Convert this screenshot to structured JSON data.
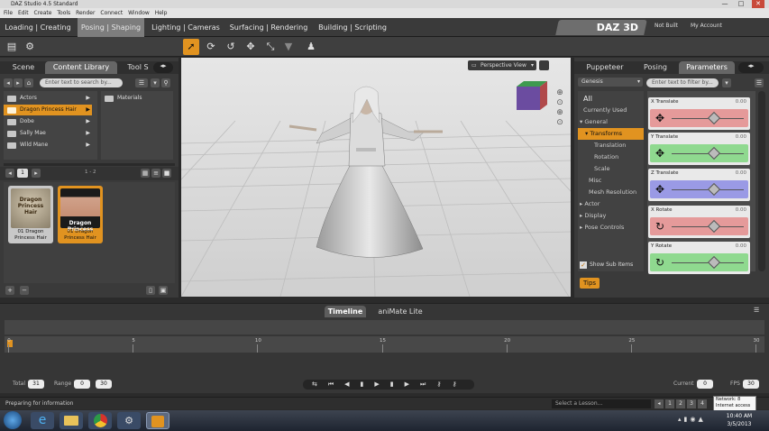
{
  "window": {
    "title": "DAZ Studio 4.5 Standard",
    "minimize": "—",
    "maximize": "□",
    "close": "✕"
  },
  "menu": [
    "File",
    "Edit",
    "Create",
    "Tools",
    "Render",
    "Connect",
    "Window",
    "Help"
  ],
  "workflow_tabs": [
    {
      "label": "Loading | Creating",
      "active": false
    },
    {
      "label": "Posing | Shaping",
      "active": true
    },
    {
      "label": "Lighting | Cameras",
      "active": false
    },
    {
      "label": "Surfacing | Rendering",
      "active": false
    },
    {
      "label": "Building | Scripting",
      "active": false
    }
  ],
  "brand": {
    "logo": "DAZ 3D",
    "links": [
      "Not Built",
      "My Account"
    ]
  },
  "toolbar": {
    "tools": [
      {
        "icon": "pointer-icon",
        "active": true
      },
      {
        "icon": "rotate-icon",
        "active": false
      },
      {
        "icon": "twist-icon",
        "active": false
      },
      {
        "icon": "translate-icon",
        "active": false
      },
      {
        "icon": "scale-icon",
        "active": false
      },
      {
        "icon": "funnel-icon",
        "active": false
      },
      {
        "icon": "figure-icon",
        "active": false
      }
    ]
  },
  "left_panel": {
    "tabs": [
      "Scene",
      "Content Library",
      "Tool S"
    ],
    "active_tab": "Content Library",
    "search_placeholder": "Enter text to search by...",
    "tree": [
      {
        "label": "Actors",
        "selected": false
      },
      {
        "label": "Dragon Princess Hair",
        "selected": true
      },
      {
        "label": "Dobe",
        "selected": false
      },
      {
        "label": "Sally Mae",
        "selected": false
      },
      {
        "label": "Wild Mane",
        "selected": false
      }
    ],
    "subfolder": "Materials",
    "page_indicator": "1",
    "page_range": "1 - 2",
    "thumbnails": [
      {
        "title": "Dragon Princess Hair",
        "caption": "01 Dragon Princess Hair"
      },
      {
        "title": "Dragon Princess",
        "caption": "01 Dragon Princess Hair"
      }
    ]
  },
  "viewport": {
    "view_label": "Perspective View"
  },
  "right_panel": {
    "tabs": [
      "Puppeteer",
      "Posing",
      "Parameters"
    ],
    "active_tab": "Parameters",
    "node_select": "Genesis",
    "filter_placeholder": "Enter text to filter by...",
    "categories": [
      {
        "label": "All",
        "selected": false,
        "indent": 0
      },
      {
        "label": "Currently Used",
        "selected": false,
        "indent": 0
      },
      {
        "label": "▾ General",
        "selected": false,
        "indent": 0
      },
      {
        "label": "▾ Transforms",
        "selected": true,
        "indent": 1
      },
      {
        "label": "Translation",
        "selected": false,
        "indent": 2
      },
      {
        "label": "Rotation",
        "selected": false,
        "indent": 2
      },
      {
        "label": "Scale",
        "selected": false,
        "indent": 2
      },
      {
        "label": "Misc",
        "selected": false,
        "indent": 1
      },
      {
        "label": "Mesh Resolution",
        "selected": false,
        "indent": 1
      },
      {
        "label": "▸ Actor",
        "selected": false,
        "indent": 0
      },
      {
        "label": "▸ Display",
        "selected": false,
        "indent": 0
      },
      {
        "label": "▸ Pose Controls",
        "selected": false,
        "indent": 0
      }
    ],
    "show_sub_items": "Show Sub Items",
    "sliders": [
      {
        "label": "X Translate",
        "value": "0.00",
        "color": "#e59a9a",
        "icon": "✥"
      },
      {
        "label": "Y Translate",
        "value": "0.00",
        "color": "#8fd98f",
        "icon": "✥"
      },
      {
        "label": "Z Translate",
        "value": "0.00",
        "color": "#9a9ae5",
        "icon": "✥"
      },
      {
        "label": "X Rotate",
        "value": "0.00",
        "color": "#e59a9a",
        "icon": "↻"
      },
      {
        "label": "Y Rotate",
        "value": "0.00",
        "color": "#8fd98f",
        "icon": "↻"
      }
    ],
    "tips_button": "Tips"
  },
  "timeline": {
    "tabs": [
      "Timeline",
      "aniMate Lite"
    ],
    "active_tab": "Timeline",
    "ticks": [
      "0",
      "5",
      "10",
      "15",
      "20",
      "25",
      "30"
    ],
    "total_label": "Total",
    "total": "31",
    "range_label": "Range",
    "range_start": "0",
    "range_end": "30",
    "current_label": "Current",
    "current": "0",
    "fps_label": "FPS",
    "fps": "30"
  },
  "status": {
    "message": "Preparing for information",
    "lesson_placeholder": "Select a Lesson...",
    "lesson_pages": [
      "1",
      "2",
      "3",
      "4"
    ]
  },
  "tooltip": {
    "line1": "Network: 8",
    "line2": "Internet access"
  },
  "taskbar": {
    "time": "10:40 AM",
    "date": "3/5/2013"
  }
}
